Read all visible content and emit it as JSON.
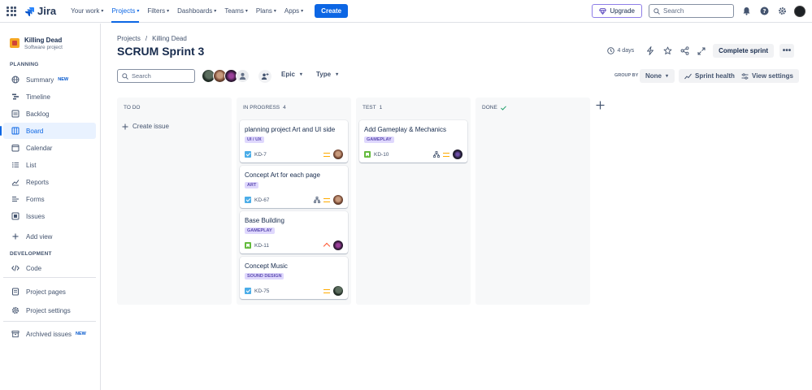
{
  "topnav": {
    "logo_text": "Jira",
    "items": [
      {
        "label": "Your work"
      },
      {
        "label": "Projects"
      },
      {
        "label": "Filters"
      },
      {
        "label": "Dashboards"
      },
      {
        "label": "Teams"
      },
      {
        "label": "Plans"
      },
      {
        "label": "Apps"
      }
    ],
    "create_label": "Create",
    "upgrade_label": "Upgrade",
    "search_placeholder": "Search"
  },
  "sidebar": {
    "project_name": "Killing Dead",
    "project_type": "Software project",
    "planning_label": "PLANNING",
    "planning_items": [
      {
        "label": "Summary",
        "badge": "NEW"
      },
      {
        "label": "Timeline"
      },
      {
        "label": "Backlog"
      },
      {
        "label": "Board"
      },
      {
        "label": "Calendar"
      },
      {
        "label": "List"
      },
      {
        "label": "Reports"
      },
      {
        "label": "Forms"
      },
      {
        "label": "Issues"
      }
    ],
    "add_view_label": "Add view",
    "development_label": "DEVELOPMENT",
    "code_label": "Code",
    "project_pages_label": "Project pages",
    "project_settings_label": "Project settings",
    "archived_label": "Archived issues",
    "archived_badge": "NEW"
  },
  "header": {
    "breadcrumb_root": "Projects",
    "breadcrumb_sep": "/",
    "breadcrumb_project": "Killing Dead",
    "title": "SCRUM Sprint 3",
    "days_left": "4 days",
    "complete_label": "Complete sprint",
    "more_label": "•••"
  },
  "toolbar": {
    "search_placeholder": "Search",
    "epic_label": "Epic",
    "type_label": "Type",
    "group_by_label": "GROUP BY",
    "group_by_value": "None",
    "sprint_health_label": "Sprint health",
    "view_settings_label": "View settings"
  },
  "columns": [
    {
      "title": "TO DO",
      "count": "",
      "create_label": "Create issue"
    },
    {
      "title": "IN PROGRESS",
      "count": "4"
    },
    {
      "title": "TEST",
      "count": "1"
    },
    {
      "title": "DONE",
      "count": ""
    }
  ],
  "cards": {
    "inprogress": [
      {
        "title": "planning project Art and UI side",
        "tag": "UI / UX",
        "key": "KD-7"
      },
      {
        "title": "Concept Art for each page",
        "tag": "ART",
        "key": "KD-67"
      },
      {
        "title": "Base Building",
        "tag": "GAMEPLAY",
        "key": "KD-11"
      },
      {
        "title": "Concept Music",
        "tag": "SOUND DESIGN",
        "key": "KD-75"
      }
    ],
    "test": [
      {
        "title": "Add Gameplay & Mechanics",
        "tag": "GAMEPLAY",
        "key": "KD-10"
      }
    ]
  },
  "colors": {
    "accent": "#0c66e4",
    "tag_bg": "#dfd8fd",
    "tag_text": "#5e4db2",
    "story_green": "#63ba3c",
    "task_blue": "#4bade8",
    "priority_medium": "#ffab00",
    "priority_high": "#ff5630"
  }
}
